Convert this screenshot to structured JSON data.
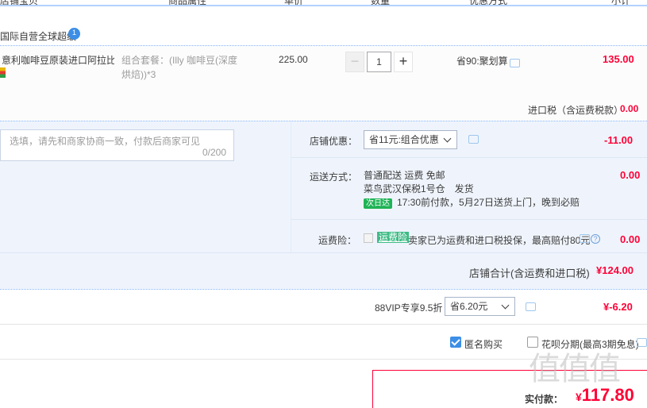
{
  "header": {
    "col_shop": "店铺宝贝",
    "col_attr": "商品属性",
    "col_price": "单价",
    "col_qty": "数量",
    "col_promo": "优惠方式",
    "col_subtotal": "小计"
  },
  "shop": {
    "name": "国际自营全球超级",
    "badge": "1"
  },
  "item": {
    "title": "意利咖啡豆原装进口阿拉比...",
    "attr": "组合套餐：(Illy 咖啡豆(深度烘焙))*3",
    "price": "225.00",
    "quantity": "1",
    "minus": "−",
    "plus": "+",
    "promo": "省90:聚划算",
    "subtotal": "135.00",
    "tax_label": "进口税（含运费税款）",
    "tax_value": "0.00"
  },
  "options": {
    "memo_placeholder": "选填，请先和商家协商一致，付款后商家可见",
    "memo_count": "0/200",
    "coupon_label": "店铺优惠：",
    "coupon_select": "省11元:组合优惠",
    "coupon_value": "-11.00",
    "shipping_label": "运送方式：",
    "shipping_line1": "普通配送 运费 免邮",
    "shipping_line2": "菜鸟武汉保税1号仓　发货",
    "next_day_tag": "次日达",
    "shipping_line3": "17:30前付款，5月27日送货上门，晚到必赔",
    "shipping_value": "0.00",
    "insurance_label": "运费险：",
    "insurance_tag": "运费险",
    "insurance_text": "卖家已为运费和进口税投保，最高赔付80元",
    "insurance_value": "0.00",
    "help": "?"
  },
  "shop_total": {
    "label": "店铺合计(含运费和进口税)",
    "value": "¥124.00"
  },
  "vip": {
    "label": "88VIP专享9.5折",
    "select": "省6.20元",
    "value": "¥-6.20"
  },
  "bottom": {
    "anonymous_label": "匿名购买",
    "anonymous_checked": true,
    "huabei_label": "花呗分期(最高3期免息)",
    "huabei_checked": false
  },
  "payment": {
    "label": "实付款：",
    "currency": "¥",
    "value": "117.80"
  },
  "watermark": "值值值",
  "colors": {
    "accent_blue": "#3c8ee6",
    "price_red": "#ff0036",
    "panel_bg": "#eff4fc",
    "insurance_green": "#3dbb85"
  }
}
